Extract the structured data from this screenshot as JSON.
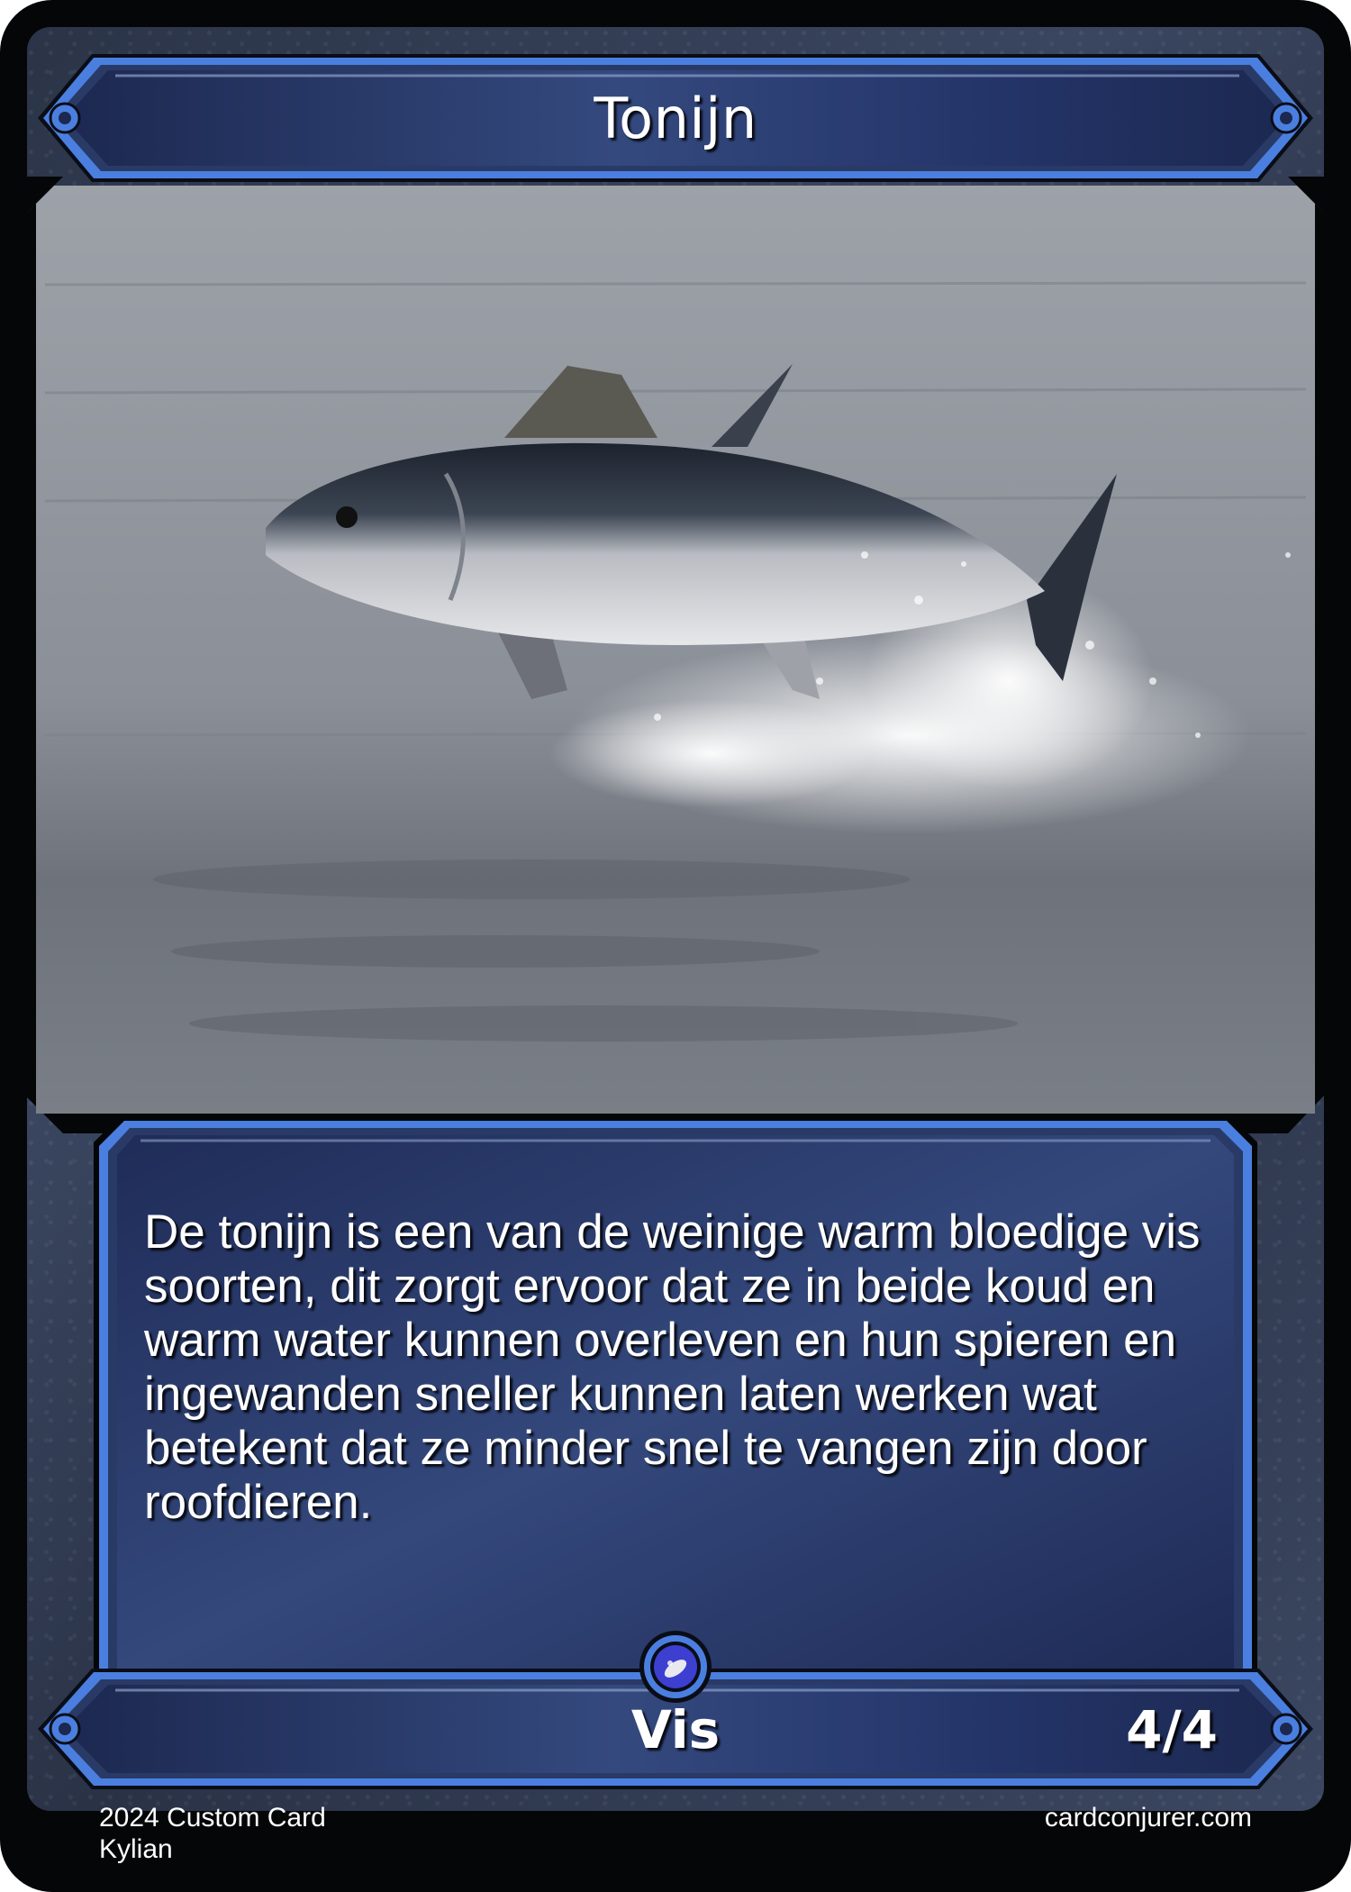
{
  "card": {
    "name": "Tonijn",
    "rules_text": "De tonijn is een van de weinige warm bloedige vis soorten, dit zorgt ervoor dat ze in beide koud en warm water kunnen overleven en hun spieren en ingewanden sneller kunnen laten werken wat betekent dat ze minder snel te vangen zijn door roofdieren.",
    "type_line": "Vis",
    "power_toughness": "4/4",
    "art_subject": "tuna leaping out of the sea",
    "set_symbol_icon": "fish-gem-icon"
  },
  "footer": {
    "info_line1": "2024 Custom Card",
    "info_line2": "Kylian",
    "site": "cardconjurer.com"
  },
  "colors": {
    "frame_blue": "#2f4373",
    "frame_blue_dark": "#1c2850",
    "edge_blue": "#4a7fe0",
    "border_black": "#050608",
    "background_steel": "#343f57"
  }
}
